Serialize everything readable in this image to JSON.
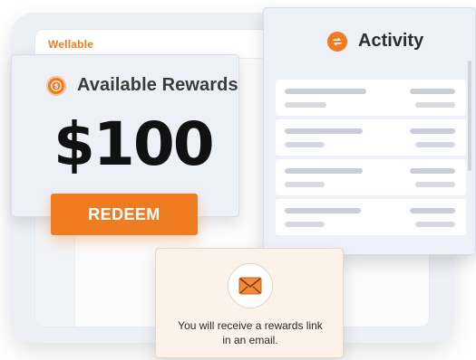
{
  "app": {
    "brand_name": "Wellable",
    "accent_color": "#f07b21"
  },
  "rewards": {
    "title": "Available Rewards",
    "amount": "$100",
    "icon": "dollar-coin-icon",
    "redeem_label": "REDEEM"
  },
  "activity": {
    "title": "Activity",
    "icon": "swap-arrows-icon",
    "rows": [
      {
        "placeholder": true
      },
      {
        "placeholder": true
      },
      {
        "placeholder": true
      },
      {
        "placeholder": true
      }
    ]
  },
  "email_notice": {
    "icon": "envelope-icon",
    "message": "You will receive a rewards link in an email."
  }
}
